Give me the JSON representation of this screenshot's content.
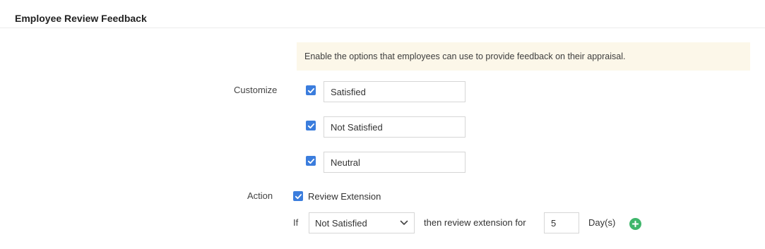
{
  "section": {
    "title": "Employee Review Feedback"
  },
  "notice": {
    "text": "Enable the options that employees can use to provide feedback on their appraisal."
  },
  "customize": {
    "label": "Customize",
    "options": [
      {
        "checked": true,
        "value": "Satisfied"
      },
      {
        "checked": true,
        "value": "Not Satisfied"
      },
      {
        "checked": true,
        "value": "Neutral"
      }
    ]
  },
  "action": {
    "label": "Action",
    "review_extension": {
      "checked": true,
      "label": "Review Extension"
    },
    "condition": {
      "if_label": "If",
      "selected": "Not Satisfied",
      "then_label": "then review extension for",
      "days_value": "5",
      "unit_label": "Day(s)"
    }
  },
  "colors": {
    "checkbox": "#3b7ddd",
    "add_button": "#3fb66b",
    "notice_bg": "#fcf7e9"
  },
  "icons": {
    "checkbox": "check-icon",
    "select": "chevron-down-icon",
    "add": "plus-circle-icon"
  }
}
